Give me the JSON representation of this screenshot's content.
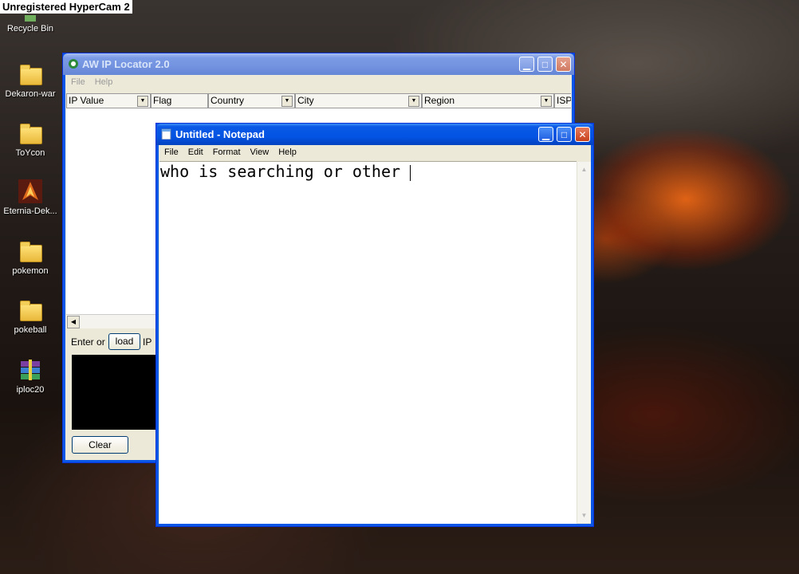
{
  "recorder_label": "Unregistered HyperCam 2",
  "desktop": {
    "icons": [
      {
        "label": "Recycle Bin",
        "icon": "recycle-bin-icon"
      },
      {
        "label": "Dekaron-war",
        "icon": "folder-icon"
      },
      {
        "label": "ToYcon",
        "icon": "folder-icon"
      },
      {
        "label": "Eternia-Dek...",
        "icon": "eternia-app-icon"
      },
      {
        "label": "pokemon",
        "icon": "folder-icon"
      },
      {
        "label": "pokeball",
        "icon": "folder-icon"
      },
      {
        "label": "iploc20",
        "icon": "winrar-archive-icon"
      }
    ]
  },
  "ip_locator": {
    "title": "AW IP Locator 2.0",
    "menu": [
      "File",
      "Help"
    ],
    "columns": [
      "IP Value",
      "Flag",
      "Country",
      "City",
      "Region",
      "ISP"
    ],
    "enter_label": "Enter or",
    "load_button": "load",
    "ip_label": "IP",
    "clear_button": "Clear"
  },
  "notepad": {
    "title": "Untitled - Notepad",
    "menu": [
      "File",
      "Edit",
      "Format",
      "View",
      "Help"
    ],
    "content": "who is searching or other "
  },
  "colors": {
    "xp_blue": "#0a58e5",
    "window_face": "#ece9d8",
    "close_red": "#c8401c"
  }
}
